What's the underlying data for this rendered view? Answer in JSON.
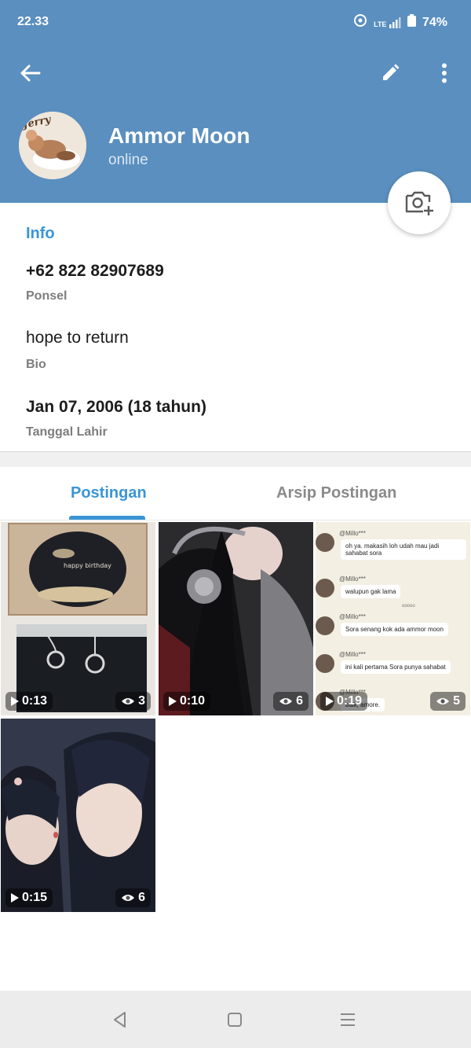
{
  "status_bar": {
    "time": "22.33",
    "network_label": "LTE",
    "battery": "74%"
  },
  "profile": {
    "name": "Ammor Moon",
    "status": "online",
    "avatar_text": "Jerry"
  },
  "info": {
    "title": "Info",
    "phone": "+62 822 82907689",
    "phone_label": "Ponsel",
    "bio": "hope to return",
    "bio_label": "Bio",
    "birthday": "Jan 07, 2006 (18 tahun)",
    "birthday_label": "Tanggal Lahir"
  },
  "tabs": [
    {
      "label": "Postingan",
      "active": true
    },
    {
      "label": "Arsip Postingan",
      "active": false
    }
  ],
  "posts": [
    {
      "duration": "0:13",
      "views": "3"
    },
    {
      "duration": "0:10",
      "views": "6"
    },
    {
      "duration": "0:19",
      "views": "5"
    },
    {
      "duration": "0:15",
      "views": "6"
    }
  ],
  "post1_cake_text": "happy birthday",
  "chat_preview": {
    "sender": "@Millo***",
    "messages": [
      "oh ya. makasih loh udah mau jadi sahabat sora",
      "walupun gak lama",
      "Sora senang kok ada ammor moon",
      "ini kali pertama Sora punya sahabat",
      "baik, amore."
    ],
    "small_text": "ooooo"
  },
  "colors": {
    "header": "#5a8fbf",
    "accent": "#3a95d5"
  }
}
